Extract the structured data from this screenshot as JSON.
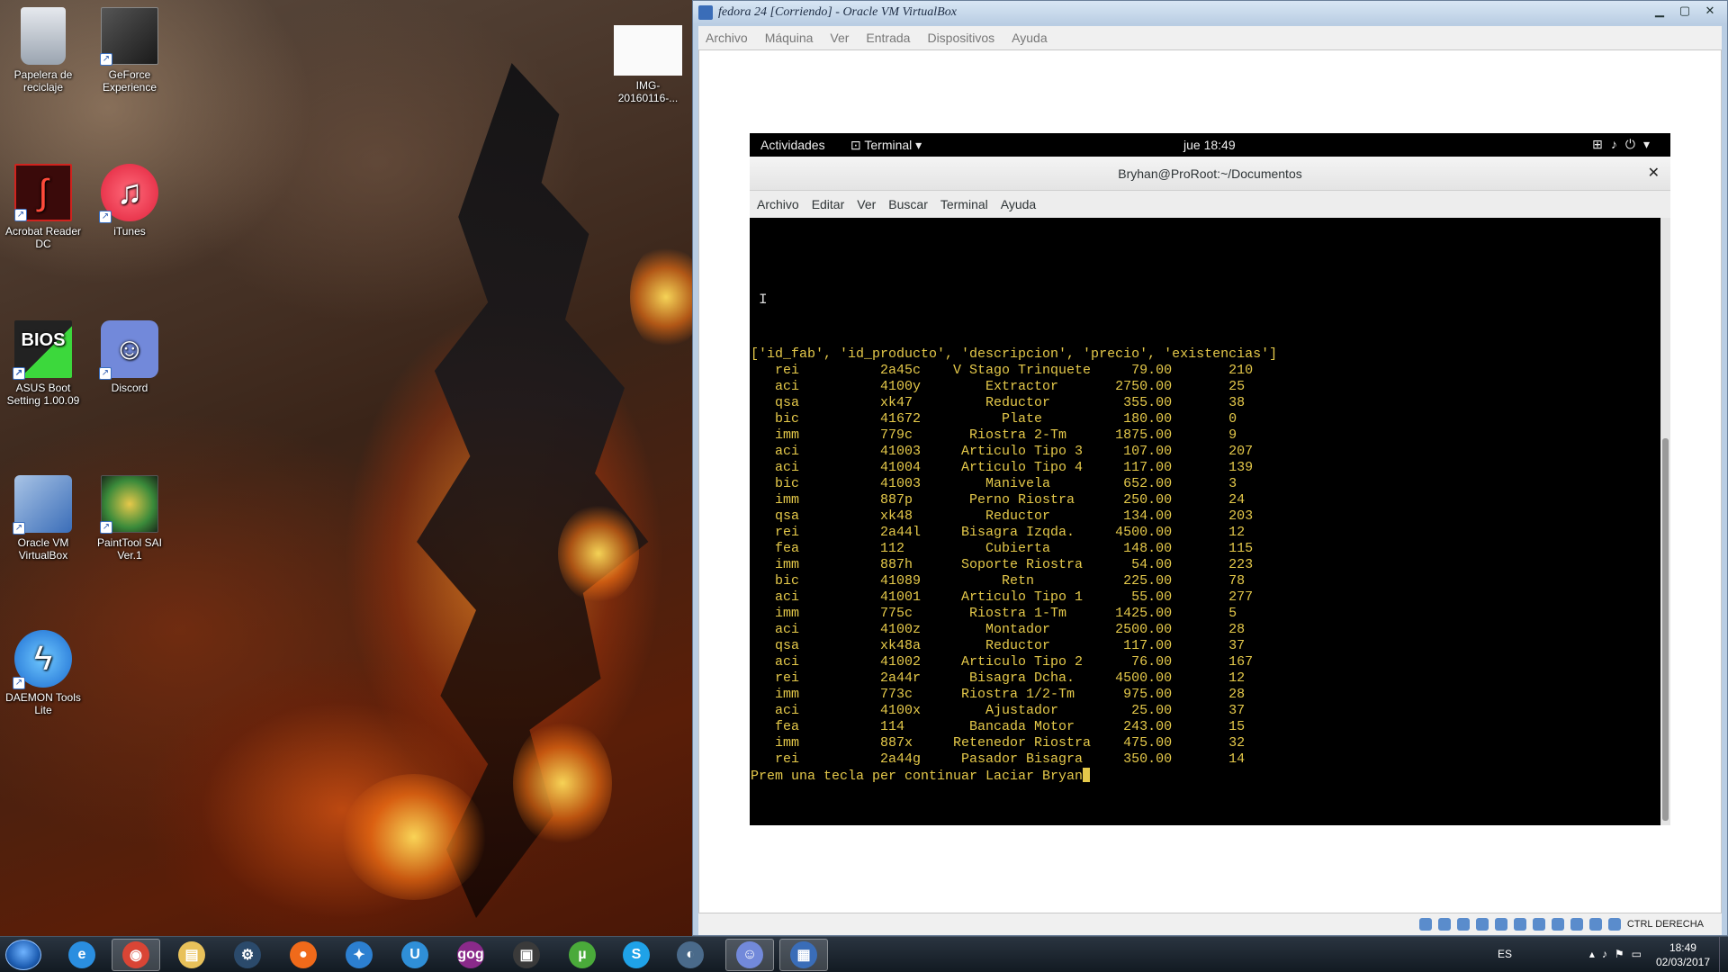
{
  "desktop": {
    "icons": [
      {
        "label": "Papelera de reciclaje",
        "icon": "recycle-bin-icon"
      },
      {
        "label": "GeForce Experience",
        "icon": "geforce-icon"
      },
      {
        "label": "IMG-20160116-...",
        "icon": "image-thumbnail-icon"
      },
      {
        "label": "Acrobat Reader DC",
        "icon": "acrobat-icon"
      },
      {
        "label": "iTunes",
        "icon": "itunes-icon"
      },
      {
        "label": "ASUS Boot Setting 1.00.09",
        "icon": "bios-icon"
      },
      {
        "label": "Discord",
        "icon": "discord-icon"
      },
      {
        "label": "Oracle VM VirtualBox",
        "icon": "virtualbox-icon"
      },
      {
        "label": "PaintTool SAI Ver.1",
        "icon": "painttool-sai-icon"
      },
      {
        "label": "DAEMON Tools Lite",
        "icon": "daemon-tools-icon"
      }
    ]
  },
  "vbox": {
    "title": "fedora 24 [Corriendo] - Oracle VM VirtualBox",
    "menu": [
      "Archivo",
      "Máquina",
      "Ver",
      "Entrada",
      "Dispositivos",
      "Ayuda"
    ],
    "status_text": "CTRL DERECHA"
  },
  "gnome": {
    "activities": "Actividades",
    "app_menu": "Terminal",
    "clock": "jue 18:49"
  },
  "terminal": {
    "title": "Bryhan@ProRoot:~/Documentos",
    "menu": [
      "Archivo",
      "Editar",
      "Ver",
      "Buscar",
      "Terminal",
      "Ayuda"
    ],
    "header_line": "['id_fab', 'id_producto', 'descripcion', 'precio', 'existencias']",
    "rows": [
      [
        "rei",
        "2a45c",
        "V Stago Trinquete",
        "79.00",
        "210"
      ],
      [
        "aci",
        "4100y",
        "Extractor",
        "2750.00",
        "25"
      ],
      [
        "qsa",
        "xk47",
        "Reductor",
        "355.00",
        "38"
      ],
      [
        "bic",
        "41672",
        "Plate",
        "180.00",
        "0"
      ],
      [
        "imm",
        "779c",
        "Riostra 2-Tm",
        "1875.00",
        "9"
      ],
      [
        "aci",
        "41003",
        "Articulo Tipo 3",
        "107.00",
        "207"
      ],
      [
        "aci",
        "41004",
        "Articulo Tipo 4",
        "117.00",
        "139"
      ],
      [
        "bic",
        "41003",
        "Manivela",
        "652.00",
        "3"
      ],
      [
        "imm",
        "887p",
        "Perno Riostra",
        "250.00",
        "24"
      ],
      [
        "qsa",
        "xk48",
        "Reductor",
        "134.00",
        "203"
      ],
      [
        "rei",
        "2a44l",
        "Bisagra Izqda.",
        "4500.00",
        "12"
      ],
      [
        "fea",
        "112",
        "Cubierta",
        "148.00",
        "115"
      ],
      [
        "imm",
        "887h",
        "Soporte Riostra",
        "54.00",
        "223"
      ],
      [
        "bic",
        "41089",
        "Retn",
        "225.00",
        "78"
      ],
      [
        "aci",
        "41001",
        "Articulo Tipo 1",
        "55.00",
        "277"
      ],
      [
        "imm",
        "775c",
        "Riostra 1-Tm",
        "1425.00",
        "5"
      ],
      [
        "aci",
        "4100z",
        "Montador",
        "2500.00",
        "28"
      ],
      [
        "qsa",
        "xk48a",
        "Reductor",
        "117.00",
        "37"
      ],
      [
        "aci",
        "41002",
        "Articulo Tipo 2",
        "76.00",
        "167"
      ],
      [
        "rei",
        "2a44r",
        "Bisagra Dcha.",
        "4500.00",
        "12"
      ],
      [
        "imm",
        "773c",
        "Riostra 1/2-Tm",
        "975.00",
        "28"
      ],
      [
        "aci",
        "4100x",
        "Ajustador",
        "25.00",
        "37"
      ],
      [
        "fea",
        "114",
        "Bancada Motor",
        "243.00",
        "15"
      ],
      [
        "imm",
        "887x",
        "Retenedor Riostra",
        "475.00",
        "32"
      ],
      [
        "rei",
        "2a44g",
        "Pasador Bisagra",
        "350.00",
        "14"
      ]
    ],
    "prompt_line": "Prem una tecla per continuar Laciar Bryan"
  },
  "taskbar": {
    "items": [
      {
        "name": "internet-explorer-icon",
        "glyph": "e",
        "color": "#2a8ee0",
        "active": false
      },
      {
        "name": "chrome-icon",
        "glyph": "◉",
        "color": "#d94535",
        "active": true
      },
      {
        "name": "file-explorer-icon",
        "glyph": "▤",
        "color": "#e8c15a",
        "active": false
      },
      {
        "name": "steam-icon",
        "glyph": "⚙",
        "color": "#2b4a6b",
        "active": false
      },
      {
        "name": "origin-icon",
        "glyph": "●",
        "color": "#f06a1a",
        "active": false
      },
      {
        "name": "battlenet-icon",
        "glyph": "✦",
        "color": "#2c7fd0",
        "active": false
      },
      {
        "name": "uplay-icon",
        "glyph": "U",
        "color": "#2f8fd8",
        "active": false
      },
      {
        "name": "gog-icon",
        "glyph": "gog",
        "color": "#8a2a8a",
        "active": false
      },
      {
        "name": "geforce-taskbar-icon",
        "glyph": "▣",
        "color": "#3a3a3a",
        "active": false
      },
      {
        "name": "utorrent-icon",
        "glyph": "µ",
        "color": "#4aaa3a",
        "active": false
      },
      {
        "name": "skype-icon",
        "glyph": "S",
        "color": "#1fa2e8",
        "active": false
      },
      {
        "name": "daemon-tools-taskbar-icon",
        "glyph": "◐",
        "color": "#4a6a8a",
        "active": false
      },
      {
        "name": "discord-taskbar-icon",
        "glyph": "☺",
        "color": "#7289da",
        "active": true
      },
      {
        "name": "virtualbox-taskbar-icon",
        "glyph": "▦",
        "color": "#3a6db8",
        "active": true
      }
    ],
    "language": "ES",
    "time": "18:49",
    "date": "02/03/2017"
  },
  "colors": {
    "terminal_text": "#e5c94a",
    "terminal_bg": "#000000"
  }
}
